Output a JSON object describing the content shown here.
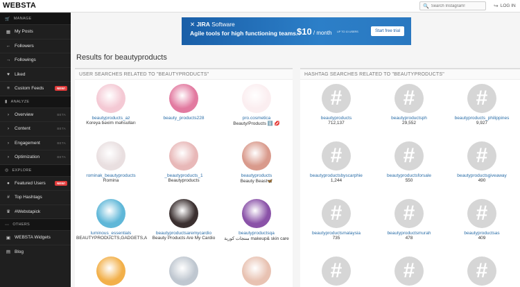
{
  "header": {
    "logo": "WEBSTA",
    "search_placeholder": "Search Instagram!",
    "login_label": "LOG IN"
  },
  "sidebar": {
    "sections": [
      {
        "title": "MANAGE",
        "icon": "cart-icon",
        "items": [
          {
            "label": "My Posts",
            "icon": "grid-icon"
          },
          {
            "label": "Followers",
            "icon": "arrow-left-icon"
          },
          {
            "label": "Followings",
            "icon": "arrow-right-icon"
          },
          {
            "label": "Liked",
            "icon": "heart-icon"
          },
          {
            "label": "Custom Feeds",
            "icon": "list-icon",
            "badge": "NEW!"
          }
        ]
      },
      {
        "title": "ANALYZE",
        "icon": "chart-icon",
        "items": [
          {
            "label": "Overview",
            "icon": "chevron-icon",
            "beta": "BETA"
          },
          {
            "label": "Content",
            "icon": "chevron-icon",
            "beta": "BETA"
          },
          {
            "label": "Engagement",
            "icon": "chevron-icon",
            "beta": "BETA"
          },
          {
            "label": "Optimization",
            "icon": "chevron-icon",
            "beta": "BETA"
          }
        ]
      },
      {
        "title": "EXPLORE",
        "icon": "compass-icon",
        "items": [
          {
            "label": "Featured Users",
            "icon": "user-icon",
            "badge": "NEW!"
          },
          {
            "label": "Top Hashtags",
            "icon": "hashtag-icon"
          },
          {
            "label": "#Webstapick",
            "icon": "trophy-icon"
          }
        ]
      },
      {
        "title": "OTHERS",
        "icon": "dots-icon",
        "items": [
          {
            "label": "WEBSTA Widgets",
            "icon": "widget-icon"
          },
          {
            "label": "Blog",
            "icon": "doc-icon"
          }
        ]
      }
    ]
  },
  "ad": {
    "brand": "JIRA",
    "brand_suffix": " Software",
    "tagline": "Agile tools for high functioning teams.",
    "price": "$10",
    "price_unit": " / month",
    "users": "UP TO 10 USERS",
    "cta": "Start free trial"
  },
  "main": {
    "results_title": "Results for beautyproducts",
    "users_heading": "USER SEARCHES RELATED TO \"BEAUTYPRODUCTS\"",
    "tags_heading": "HASHTAG SEARCHES RELATED TO \"BEAUTYPRODUCTS\"",
    "users": [
      {
        "name": "beautyproducts_az",
        "bio": "Koreya bəxim məhsulları",
        "color": "#f4c9d4"
      },
      {
        "name": "beauty_products228",
        "bio": "",
        "color": "#e27aa0"
      },
      {
        "name": "pro.cosmetica",
        "bio": "Beauty/Products ℹ️ 💋",
        "color": "#fbeef0"
      },
      {
        "name": "rominak_beautyproducts",
        "bio": "Romina",
        "color": "#e9dfe0"
      },
      {
        "name": "_beautyproducts_1",
        "bio": "Beautyproducts",
        "color": "#e8b8b8"
      },
      {
        "name": "beautyproducts",
        "bio": "Beauty Beast🦋",
        "color": "#d99a8c"
      },
      {
        "name": "luminous_essentials",
        "bio": "BEAUTYPRODUCTS,GADGETS,A",
        "color": "#5fb7d8"
      },
      {
        "name": "beautyproductsaremycardio",
        "bio": "Beauty Products Are My Cardio",
        "color": "#3b3030"
      },
      {
        "name": "beautyproductsqa",
        "bio": "منتجات كورية makeup& skin care",
        "color": "#8a52a8"
      },
      {
        "name": "",
        "bio": "",
        "color": "#f2b04a"
      },
      {
        "name": "",
        "bio": "",
        "color": "#bfc7d0"
      },
      {
        "name": "",
        "bio": "",
        "color": "#e8c2b2"
      }
    ],
    "tags": [
      {
        "name": "beautyproducts",
        "count": "712,137"
      },
      {
        "name": "beautyproductsph",
        "count": "29,552"
      },
      {
        "name": "beautyproducts_philippines",
        "count": "9,927"
      },
      {
        "name": "beautyproductsbyscarphie",
        "count": "1,244"
      },
      {
        "name": "beautyproductsforsale",
        "count": "550"
      },
      {
        "name": "beautyproductsgiveaway",
        "count": "490"
      },
      {
        "name": "beautyproductsmalaysia",
        "count": "735"
      },
      {
        "name": "beautyproductsmurah",
        "count": "478"
      },
      {
        "name": "beautyproductsas",
        "count": "409"
      },
      {
        "name": "",
        "count": ""
      },
      {
        "name": "",
        "count": ""
      },
      {
        "name": "",
        "count": ""
      }
    ]
  }
}
